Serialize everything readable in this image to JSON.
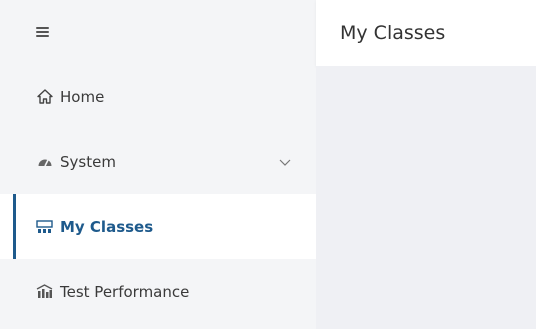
{
  "header": {
    "title": "My Classes"
  },
  "sidebar": {
    "menu_icon": "hamburger-menu-icon",
    "items": [
      {
        "label": "Home",
        "icon": "home-icon"
      },
      {
        "label": "System",
        "icon": "gauge-icon",
        "expand_icon": "chevron-down-icon"
      },
      {
        "label": "My Classes",
        "icon": "classroom-icon",
        "active": true
      },
      {
        "label": "Test Performance",
        "icon": "bar-chart-icon"
      }
    ]
  },
  "colors": {
    "accent": "#1e5a8c",
    "sidebar_bg": "#f4f5f7",
    "content_bg": "#eff0f4",
    "active_bg": "#ffffff"
  }
}
